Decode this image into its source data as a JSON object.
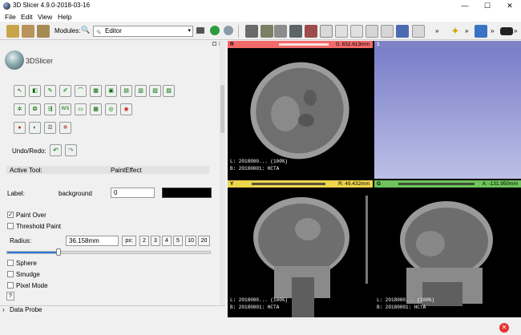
{
  "window": {
    "title": "3D Slicer 4.9.0-2018-03-16",
    "minimize": "—",
    "maximize": "☐",
    "close": "✕"
  },
  "menubar": {
    "items": [
      "File",
      "Edit",
      "View",
      "Help"
    ]
  },
  "toolbar": {
    "modules_label": "Modules:",
    "module_selected": "Editor",
    "dropdown_arrow": "▾",
    "more": "»"
  },
  "app": {
    "logo_text": "3DSlicer"
  },
  "editor": {
    "undo_redo_label": "Undo/Redo:",
    "undo_icon": "↶",
    "redo_icon": "↷",
    "active_tool_label": "Active Tool:",
    "active_tool_value": "PaintEffect",
    "label_label": "Label:",
    "label_name": "background",
    "label_value": "0",
    "paint_over": "Paint Over",
    "threshold_paint": "Threshold Paint",
    "radius_label": "Radius:",
    "radius_value": "36.158mm",
    "px_button": "px:",
    "radius_presets": [
      "2",
      "3",
      "4",
      "5",
      "10",
      "20"
    ],
    "sphere": "Sphere",
    "smudge": "Smudge",
    "pixel_mode": "Pixel Mode",
    "help_button": "?",
    "paint_over_checked": true
  },
  "data_probe": {
    "label": "Data Probe",
    "arrow": "›"
  },
  "views": {
    "red": {
      "tag": "R",
      "readout": "S: 832.613mm",
      "ann_top": "L: 2018000... (100%)",
      "ann_bottom": "B: 20180001: HCTA",
      "color": "#f26a6a"
    },
    "three_d": {
      "tag": "1",
      "color": "#7f82c4"
    },
    "yellow": {
      "tag": "Y",
      "readout": "R: 49.432mm",
      "ann_top": "L: 2018000... (100%)",
      "ann_bottom": "B: 20180001: HCTA",
      "color": "#edd54c"
    },
    "green": {
      "tag": "G",
      "readout": "A: -131.950mm",
      "ann_top": "L: 2018000... (100%)",
      "ann_bottom": "B: 20180001: HCTA",
      "color": "#6ec45a"
    }
  },
  "status": {
    "error_icon": "✕"
  }
}
